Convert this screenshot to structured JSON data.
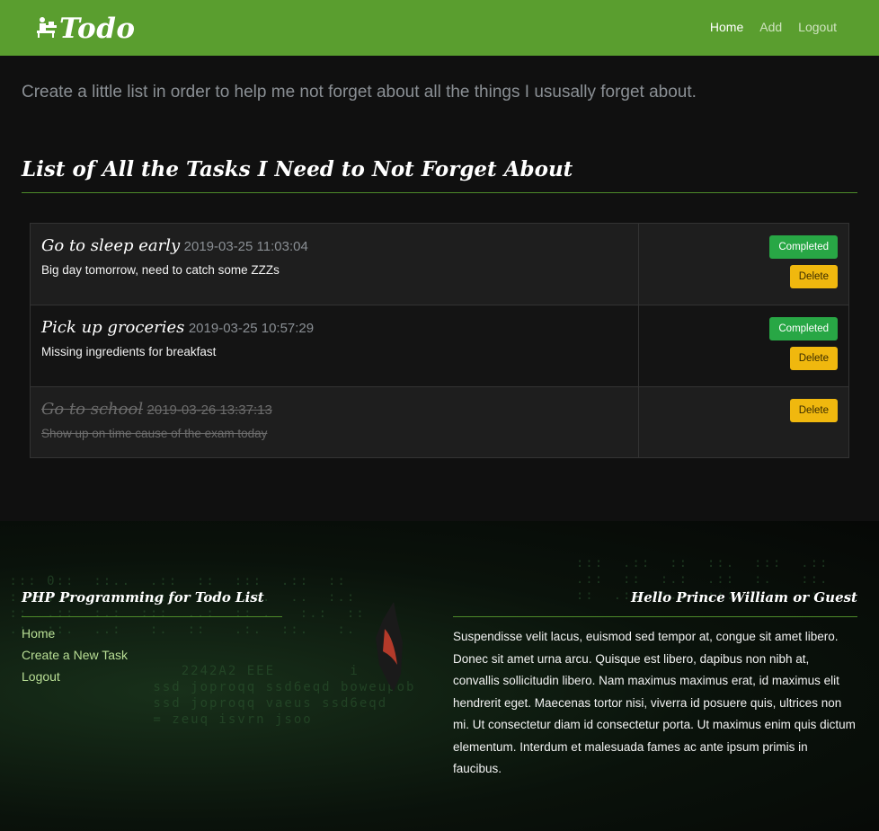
{
  "brand": {
    "name": "Todo",
    "logo_icon": "desk-person-icon"
  },
  "nav": {
    "home": "Home",
    "add": "Add",
    "logout": "Logout"
  },
  "hero": {
    "lead": "Create a little list in order to help me not forget about all the things I ususally forget about."
  },
  "section_title": "List of All the Tasks I Need to Not Forget About",
  "tasks": [
    {
      "title": "Go to sleep early",
      "date": "2019-03-25 11:03:04",
      "description": "Big day tomorrow, need to catch some ZZZs",
      "completed": false,
      "complete_label": "Completed",
      "delete_label": "Delete"
    },
    {
      "title": "Pick up groceries",
      "date": "2019-03-25 10:57:29",
      "description": "Missing ingredients for breakfast",
      "completed": false,
      "complete_label": "Completed",
      "delete_label": "Delete"
    },
    {
      "title": "Go to school",
      "date": "2019-03-26 13:37:13",
      "description": "Show up on time cause of the exam today",
      "completed": true,
      "delete_label": "Delete"
    }
  ],
  "footer": {
    "left_heading": "PHP Programming for Todo List",
    "links": {
      "home": "Home",
      "create": "Create a New Task",
      "logout": "Logout"
    },
    "right_heading": "Hello Prince William or Guest",
    "text": "Suspendisse velit lacus, euismod sed tempor at, congue sit amet libero. Donec sit amet urna arcu. Quisque est libero, dapibus non nibh at, convallis sollicitudin libero. Nam maximus maximus erat, id maximus elit hendrerit eget. Maecenas tortor nisi, viverra id posuere quis, ultrices non mi. Ut consectetur diam id consectetur porta. Ut maximus enim quis dictum elementum. Interdum et malesuada fames ac ante ipsum primis in faucibus."
  },
  "colors": {
    "navbar": "#5a9e2f",
    "completed_button": "#28a745",
    "delete_button": "#f0b80e",
    "accent_rule": "#4d8a2a"
  }
}
